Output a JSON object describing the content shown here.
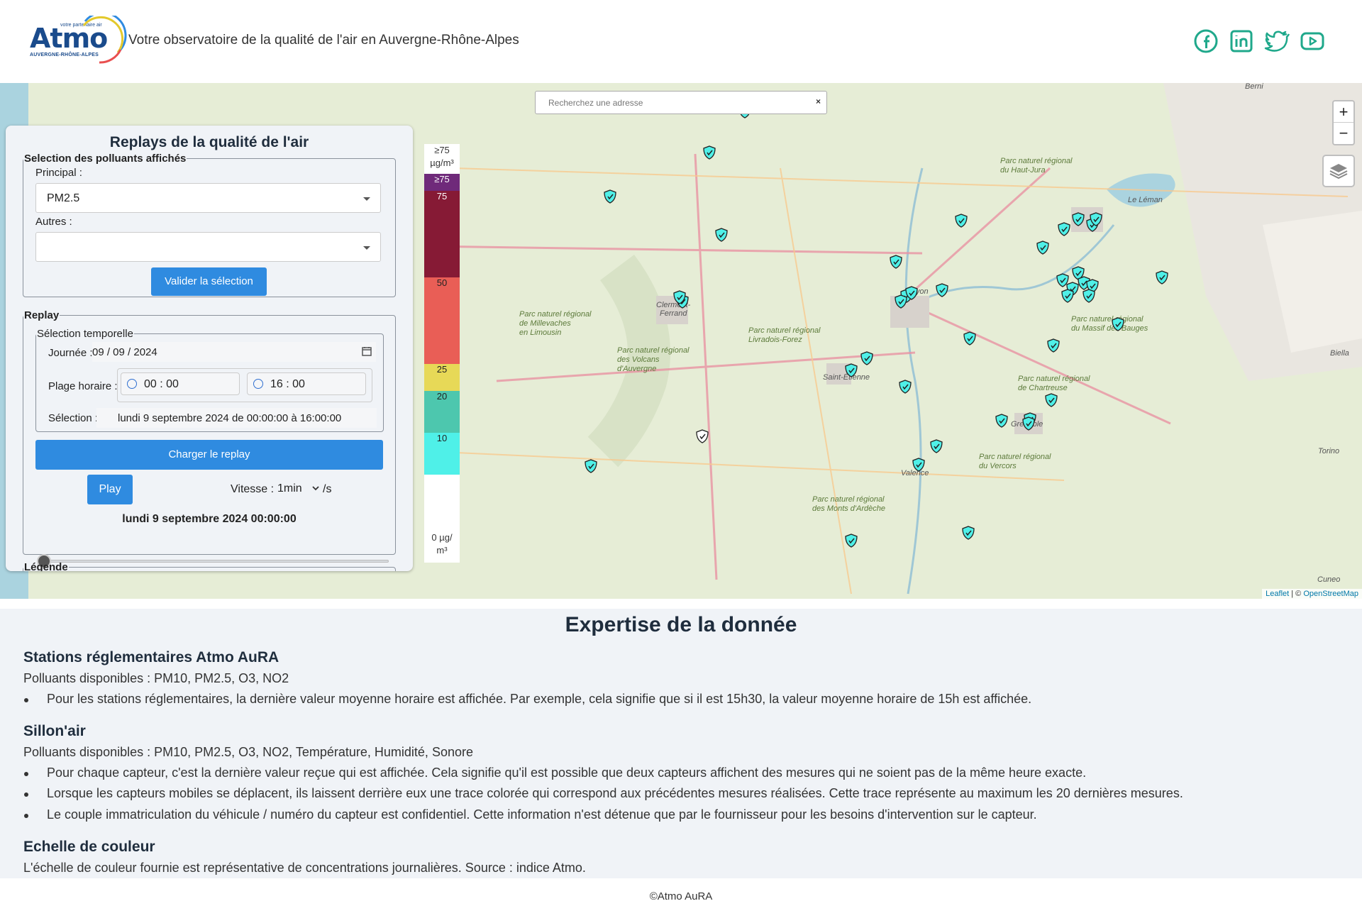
{
  "header": {
    "logo_text": "Atmo",
    "logo_tagline": "votre partenaire air",
    "logo_region": "AUVERGNE-RHÔNE-ALPES",
    "title": "Votre observatoire de la qualité de l'air en Auvergne-Rhône-Alpes",
    "socials": [
      "facebook-icon",
      "linkedin-icon",
      "twitter-icon",
      "youtube-icon"
    ],
    "accent_color": "#1fa88b"
  },
  "map": {
    "search_placeholder": "Recherchez une adresse",
    "search_clear": "×",
    "zoom_in": "+",
    "zoom_out": "−",
    "attribution_leaflet": "Leaflet",
    "attribution_sep": " | © ",
    "attribution_osm": "OpenStreetMap",
    "place_labels": [
      "Berne",
      "Lyon",
      "Clermont-Ferrand",
      "Saint-Étienne",
      "Grenoble",
      "Valence",
      "Torino",
      "Cuneo",
      "Biella",
      "Le Léman",
      "Parc naturel régional de Millevaches en Limousin",
      "Parc naturel régional des Volcans d'Auvergne",
      "Parc naturel régional Livradois-Forez",
      "Parc naturel régional des Monts d'Ardèche",
      "Parc naturel régional du Vercors",
      "Parc naturel régional de Chartreuse",
      "Parc naturel régional du Massif des Bauges",
      "Parc naturel régional du Haut-Jura"
    ]
  },
  "panel": {
    "title": "Replays de la qualité de l'air",
    "pollutants_legend": "Selection des polluants affichés",
    "principal_label": "Principal :",
    "principal_value": "PM2.5",
    "autres_label": "Autres :",
    "autres_value": "",
    "validate_button": "Valider la sélection",
    "replay_legend": "Replay",
    "time_selection_legend": "Sélection temporelle",
    "day_label": "Journée :",
    "day_value": "09 / 09 / 2024",
    "range_label": "Plage horaire :",
    "range_start": "00 : 00",
    "range_end": "16 : 00",
    "selection_label": "Sélection :",
    "selection_value": "lundi 9 septembre 2024 de 00:00:00 à 16:00:00",
    "load_button": "Charger le replay",
    "play_button": "Play",
    "speed_label": "Vitesse :",
    "speed_value": "1min",
    "speed_unit": "/s",
    "current_time": "lundi 9 septembre 2024 00:00:00",
    "slider_position": 0,
    "legend_title": "Légende"
  },
  "scale": {
    "top_label": "≥75",
    "top_unit": "µg/m³",
    "segments": [
      {
        "label": "≥75",
        "color": "#6f2a7a"
      },
      {
        "label": "75",
        "color": "#861a35"
      },
      {
        "label": "50",
        "color": "#e95e56"
      },
      {
        "label": "25",
        "color": "#e7d957"
      },
      {
        "label": "20",
        "color": "#4dc7ae"
      },
      {
        "label": "10",
        "color": "#4ff0e8"
      }
    ],
    "bottom_label": "0 µg/",
    "bottom_unit": "m³"
  },
  "content": {
    "title": "Expertise de la donnée",
    "s1_title": "Stations réglementaires Atmo AuRA",
    "s1_pollutants": "Polluants disponibles : PM10, PM2.5, O3, NO2",
    "s1_bullets": [
      "Pour les stations réglementaires, la dernière valeur moyenne horaire est affichée. Par exemple, cela signifie que si il est 15h30, la valeur moyenne horaire de 15h est affichée."
    ],
    "s2_title": "Sillon'air",
    "s2_pollutants": "Polluants disponibles : PM10, PM2.5, O3, NO2, Température, Humidité, Sonore",
    "s2_bullets": [
      "Pour chaque capteur, c'est la dernière valeur reçue qui est affichée. Cela signifie qu'il est possible que deux capteurs affichent des mesures qui ne soient pas de la même heure exacte.",
      "Lorsque les capteurs mobiles se déplacent, ils laissent derrière eux une trace colorée qui correspond aux précédentes mesures réalisées. Cette trace représente au maximum les 20 dernières mesures.",
      "Le couple immatriculation du véhicule / numéro du capteur est confidentiel. Cette information n'est détenue que par le fournisseur pour les besoins d'intervention sur le capteur."
    ],
    "s3_title": "Echelle de couleur",
    "s3_text": "L'échelle de couleur fournie est représentative de concentrations journalières. Source : indice Atmo."
  },
  "footer": {
    "text": "©Atmo AuRA"
  }
}
